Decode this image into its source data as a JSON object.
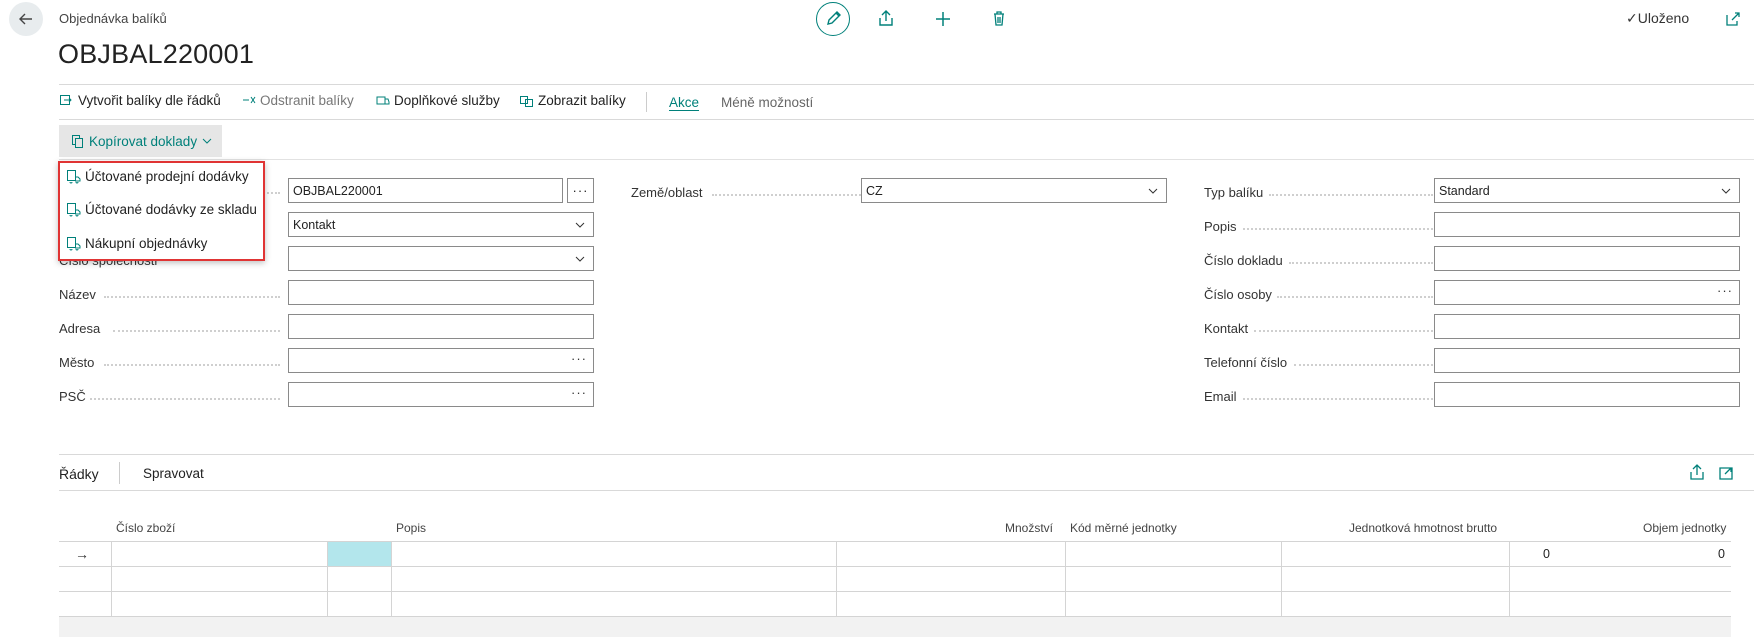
{
  "header": {
    "breadcrumb": "Objednávka balíků",
    "title": "OBJBAL220001",
    "saved_label": "Uloženo"
  },
  "actions": {
    "create_packages": "Vytvořit balíky dle řádků",
    "remove_packages": "Odstranit balíky",
    "additional_services": "Doplňkové služby",
    "show_packages": "Zobrazit balíky",
    "akce": "Akce",
    "less_options": "Méně možností",
    "copy_documents": "Kopírovat doklady"
  },
  "menu": {
    "items": [
      "Účtované prodejní dodávky",
      "Účtované dodávky ze skladu",
      "Nákupní objednávky"
    ]
  },
  "form": {
    "left": {
      "no_value": "OBJBAL220001",
      "type_value": "Kontakt",
      "company_label": "Číslo společnosti",
      "name_label": "Název",
      "address_label": "Adresa",
      "city_label": "Město",
      "zip_label": "PSČ"
    },
    "middle": {
      "country_label": "Země/oblast",
      "country_value": "CZ"
    },
    "right": {
      "package_type_label": "Typ balíku",
      "package_type_value": "Standard",
      "description_label": "Popis",
      "doc_no_label": "Číslo dokladu",
      "person_no_label": "Číslo osoby",
      "contact_label": "Kontakt",
      "phone_label": "Telefonní číslo",
      "email_label": "Email"
    }
  },
  "lines": {
    "title": "Řádky",
    "manage": "Spravovat",
    "columns": {
      "item_no": "Číslo zboží",
      "description": "Popis",
      "quantity": "Množství",
      "uom": "Kód měrné jednotky",
      "gross_weight": "Jednotková hmotnost brutto",
      "unit_volume": "Objem jednotky"
    },
    "row1": {
      "gross_weight": "0",
      "unit_volume": "0"
    }
  },
  "colors": {
    "accent": "#00807a",
    "highlight": "#e03434",
    "selected_cell": "#b3e6ec"
  }
}
